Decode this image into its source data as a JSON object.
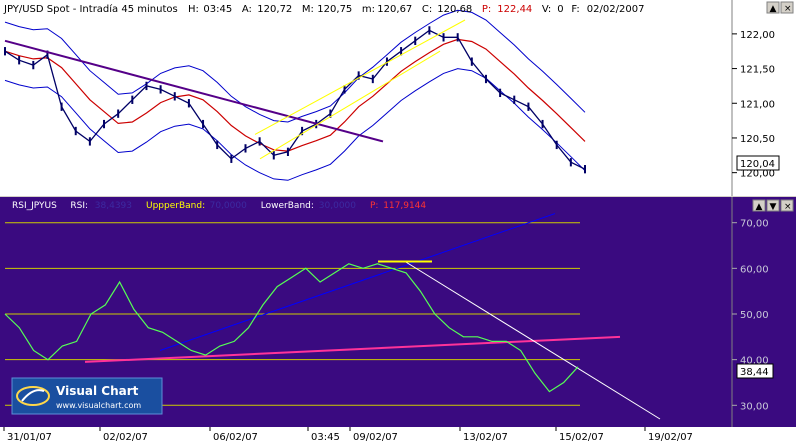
{
  "upper": {
    "header": {
      "symbol": "JPY/USD Spot - Intradía 45 minutos",
      "fields": [
        {
          "label": "H:",
          "value": "03:45",
          "color": "#000000"
        },
        {
          "label": "A:",
          "value": "120,72",
          "color": "#000000"
        },
        {
          "label": "M:",
          "value": "120,75",
          "color": "#000000"
        },
        {
          "label": "m:",
          "value": "120,67",
          "color": "#000000"
        },
        {
          "label": "C:",
          "value": "120,68",
          "color": "#000000"
        },
        {
          "label": "P:",
          "value": "122,44",
          "color": "#cc0000"
        },
        {
          "label": "V:",
          "value": "0",
          "color": "#000000"
        },
        {
          "label": "F:",
          "value": "02/02/2007",
          "color": "#000000"
        }
      ]
    },
    "yticks": [
      "122,00",
      "121,50",
      "121,00",
      "120,50",
      "120,00"
    ],
    "last_price": "120,04"
  },
  "lower": {
    "header": {
      "name": "RSI_JPYUS",
      "items": [
        {
          "label": "RSI:",
          "value": "38,4393",
          "label_color": "#ffffff",
          "value_color": "#3c2aa0"
        },
        {
          "label": "UppperBand:",
          "value": "70,0000",
          "label_color": "#ffff00",
          "value_color": "#3c2aa0"
        },
        {
          "label": "LowerBand:",
          "value": "30,0000",
          "label_color": "#ffffff",
          "value_color": "#3c2aa0"
        },
        {
          "label": "P:",
          "value": "117,9144",
          "label_color": "#ff3333",
          "value_color": "#ff3333"
        }
      ]
    },
    "yticks": [
      "70,00",
      "60,00",
      "50,00",
      "40,00",
      "30,00"
    ],
    "last_value": "38,44"
  },
  "x_axis": {
    "labels": [
      "31/01/07",
      "02/02/07",
      "06/02/07",
      "03:45",
      "09/02/07",
      "13/02/07",
      "15/02/07",
      "19/02/07"
    ]
  },
  "watermark": {
    "brand": "Visual Chart",
    "url": "www.visualchart.com"
  },
  "window_buttons": {
    "up": "▲",
    "down": "▼",
    "close": "×"
  },
  "colors": {
    "upper_bg": "#ffffff",
    "lower_bg": "#3a0a80",
    "price": "#000066",
    "bands": "#0000cc",
    "moving_average": "#cc0000",
    "downtrend": "#550088",
    "channel": "#ffff00",
    "rsi": "#55ff55",
    "band_lines": "#cccc00",
    "rsi_trend_blue": "#0000ff",
    "rsi_trend_pink": "#ff3399",
    "rsi_trend_white": "#ffffff"
  },
  "chart_data": [
    {
      "type": "line",
      "title": "JPY/USD Spot - Intradía 45 minutos",
      "ylim": [
        119.75,
        122.2
      ],
      "x_labels": [
        "31/01/07",
        "02/02/07",
        "06/02/07",
        "03:45",
        "09/02/07",
        "13/02/07",
        "15/02/07",
        "19/02/07"
      ],
      "series": [
        {
          "name": "JPY/USD Spot",
          "values": [
            121.75,
            121.62,
            121.55,
            121.7,
            120.95,
            120.6,
            120.45,
            120.7,
            120.85,
            121.05,
            121.25,
            121.2,
            121.1,
            121.0,
            120.7,
            120.4,
            120.2,
            120.35,
            120.45,
            120.25,
            120.3,
            120.6,
            120.7,
            120.85,
            121.2,
            121.4,
            121.35,
            121.6,
            121.75,
            121.9,
            122.05,
            121.95,
            121.95,
            121.6,
            121.35,
            121.15,
            121.05,
            120.95,
            120.7,
            120.4,
            120.15,
            120.05
          ]
        }
      ]
    },
    {
      "type": "line",
      "title": "RSI_JPYUS",
      "ylim": [
        27,
        73
      ],
      "x_labels": [
        "31/01/07",
        "02/02/07",
        "06/02/07",
        "03:45",
        "09/02/07",
        "13/02/07",
        "15/02/07",
        "19/02/07"
      ],
      "series": [
        {
          "name": "RSI",
          "values": [
            50,
            47,
            42,
            40,
            43,
            44,
            50,
            52,
            57,
            51,
            47,
            46,
            44,
            42,
            41,
            43,
            44,
            47,
            52,
            56,
            58,
            60,
            57,
            59,
            61,
            60,
            61,
            60,
            59,
            55,
            50,
            47,
            45,
            45,
            44,
            44,
            42,
            37,
            33,
            35,
            38.44
          ]
        }
      ]
    }
  ]
}
